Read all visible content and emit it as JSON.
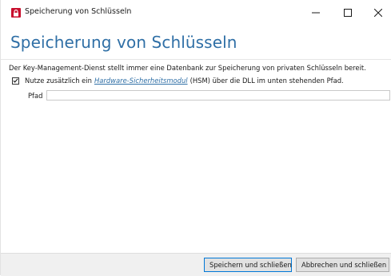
{
  "window": {
    "title": "Speicherung von Schlüsseln",
    "controls": {
      "minimize": "—",
      "maximize": "☐",
      "close": "✕"
    }
  },
  "page": {
    "heading": "Speicherung von Schlüsseln",
    "description": "Der Key-Management-Dienst stellt immer eine Datenbank zur Speicherung von privaten Schlüsseln bereit."
  },
  "hsm_option": {
    "checked": true,
    "prefix": "Nutze zusätzlich ein",
    "link_text": "Hardware-Sicherheitsmodul",
    "suffix": "(HSM) über die DLL im unten stehenden Pfad."
  },
  "path_field": {
    "label": "Pfad",
    "value": ""
  },
  "footer": {
    "save_label": "Speichern und schließen",
    "cancel_label": "Abbrechen und schließen"
  },
  "colors": {
    "accent": "#2f6fa6",
    "app_icon": "#c8102e",
    "footer_bg": "#f0f0f0"
  }
}
